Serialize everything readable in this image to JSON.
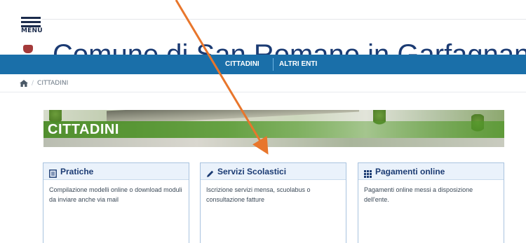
{
  "header": {
    "menu_label": "MENU",
    "site_title": "Comune di San Romano in Garfagnana"
  },
  "nav": {
    "items": [
      {
        "label": "CITTADINI"
      },
      {
        "label": "ALTRI ENTI"
      }
    ],
    "color": "#1a6fa9"
  },
  "breadcrumb": {
    "home_icon": "home-icon",
    "current": "CITTADINI"
  },
  "banner": {
    "title": "CITTADINI"
  },
  "cards": [
    {
      "icon": "document-icon",
      "title": "Pratiche",
      "description": "Compilazione modelli online o download moduli da inviare anche via mail"
    },
    {
      "icon": "pencil-icon",
      "title": "Servizi Scolastici",
      "description": "Iscrizione servizi mensa, scuolabus o consultazione fatture"
    },
    {
      "icon": "grid-icon",
      "title": "Pagamenti online",
      "description": "Pagamenti online messi a disposizione dell'ente."
    }
  ],
  "annotation": {
    "arrow_color": "#e8762c"
  }
}
